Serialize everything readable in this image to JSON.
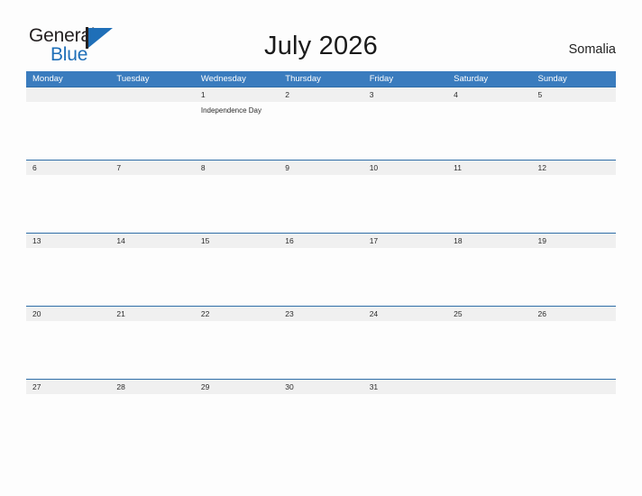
{
  "brand": {
    "name_part1": "General",
    "name_part2": "Blue",
    "mark": "flag-triangle-icon"
  },
  "header": {
    "title": "July 2026",
    "country": "Somalia"
  },
  "colors": {
    "header_blue": "#3a7cbe",
    "row_rule_blue": "#2f6ea8",
    "date_band_gray": "#f0f0f0",
    "brand_blue": "#1f6fb8",
    "text_dark": "#231f20"
  },
  "calendar": {
    "weekdays": [
      "Monday",
      "Tuesday",
      "Wednesday",
      "Thursday",
      "Friday",
      "Saturday",
      "Sunday"
    ],
    "weeks": [
      [
        {
          "num": "",
          "events": []
        },
        {
          "num": "",
          "events": []
        },
        {
          "num": "1",
          "events": [
            "Independence Day"
          ]
        },
        {
          "num": "2",
          "events": []
        },
        {
          "num": "3",
          "events": []
        },
        {
          "num": "4",
          "events": []
        },
        {
          "num": "5",
          "events": []
        }
      ],
      [
        {
          "num": "6",
          "events": []
        },
        {
          "num": "7",
          "events": []
        },
        {
          "num": "8",
          "events": []
        },
        {
          "num": "9",
          "events": []
        },
        {
          "num": "10",
          "events": []
        },
        {
          "num": "11",
          "events": []
        },
        {
          "num": "12",
          "events": []
        }
      ],
      [
        {
          "num": "13",
          "events": []
        },
        {
          "num": "14",
          "events": []
        },
        {
          "num": "15",
          "events": []
        },
        {
          "num": "16",
          "events": []
        },
        {
          "num": "17",
          "events": []
        },
        {
          "num": "18",
          "events": []
        },
        {
          "num": "19",
          "events": []
        }
      ],
      [
        {
          "num": "20",
          "events": []
        },
        {
          "num": "21",
          "events": []
        },
        {
          "num": "22",
          "events": []
        },
        {
          "num": "23",
          "events": []
        },
        {
          "num": "24",
          "events": []
        },
        {
          "num": "25",
          "events": []
        },
        {
          "num": "26",
          "events": []
        }
      ],
      [
        {
          "num": "27",
          "events": []
        },
        {
          "num": "28",
          "events": []
        },
        {
          "num": "29",
          "events": []
        },
        {
          "num": "30",
          "events": []
        },
        {
          "num": "31",
          "events": []
        },
        {
          "num": "",
          "events": []
        },
        {
          "num": "",
          "events": []
        }
      ]
    ]
  }
}
